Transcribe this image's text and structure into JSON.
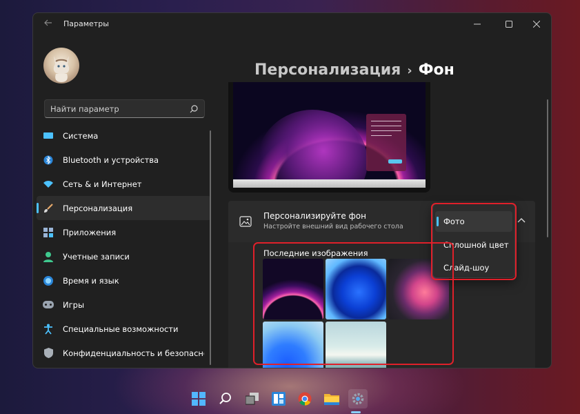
{
  "window": {
    "title": "Параметры"
  },
  "sidebar": {
    "search_placeholder": "Найти параметр",
    "items": [
      {
        "label": "Система",
        "icon": "monitor-icon"
      },
      {
        "label": "Bluetooth и устройства",
        "icon": "bluetooth-icon"
      },
      {
        "label": "Сеть & и Интернет",
        "icon": "wifi-icon"
      },
      {
        "label": "Персонализация",
        "icon": "brush-icon",
        "active": true
      },
      {
        "label": "Приложения",
        "icon": "apps-icon"
      },
      {
        "label": "Учетные записи",
        "icon": "account-icon"
      },
      {
        "label": "Время и язык",
        "icon": "globe-clock-icon"
      },
      {
        "label": "Игры",
        "icon": "gamepad-icon"
      },
      {
        "label": "Специальные возможности",
        "icon": "accessibility-icon"
      },
      {
        "label": "Конфиденциальность и безопаснос",
        "icon": "shield-icon"
      }
    ]
  },
  "breadcrumb": {
    "parent": "Персонализация",
    "separator": "›",
    "current": "Фон"
  },
  "background_card": {
    "title": "Персонализируйте фон",
    "subtitle": "Настройте внешний вид рабочего стола",
    "selected": "Фото"
  },
  "dropdown": {
    "options": [
      "Фото",
      "Сплошной цвет",
      "Слайд-шоу"
    ],
    "selected_index": 0
  },
  "recent_images": {
    "label": "Последние изображения",
    "count": 5
  },
  "accent_color": "#4cc2ff",
  "highlight_color": "#e0202a",
  "taskbar": {
    "icons": [
      "start-icon",
      "search-icon",
      "task-view-icon",
      "widgets-icon",
      "chrome-icon",
      "file-explorer-icon",
      "settings-icon"
    ]
  }
}
